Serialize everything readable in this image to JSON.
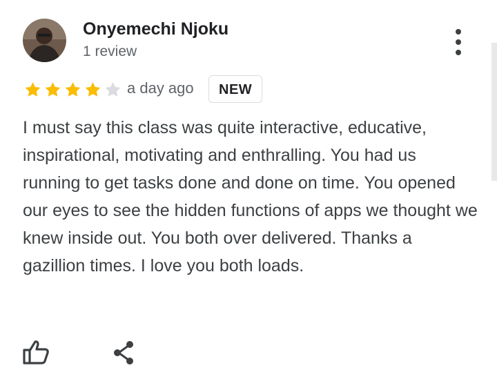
{
  "review": {
    "author_name": "Onyemechi Njoku",
    "review_count": "1 review",
    "rating": 4,
    "rating_max": 5,
    "timestamp": "a day ago",
    "badge": "NEW",
    "text": "I must say this class was quite interactive, educative, inspirational, motivating and enthralling. You had us running to get tasks done and done on time. You opened our eyes to see the hidden functions of apps we thought we knew inside out. You both over delivered. Thanks a gazillion times. I love you both loads."
  },
  "icons": {
    "more": "more-vert-icon",
    "like": "thumbs-up-icon",
    "share": "share-icon",
    "star_filled": "star-icon",
    "star_empty": "star-outline-icon"
  },
  "colors": {
    "star_filled": "#fbbc04",
    "star_empty": "#dadce0",
    "text": "#3c4043",
    "secondary_text": "#5f6368"
  }
}
